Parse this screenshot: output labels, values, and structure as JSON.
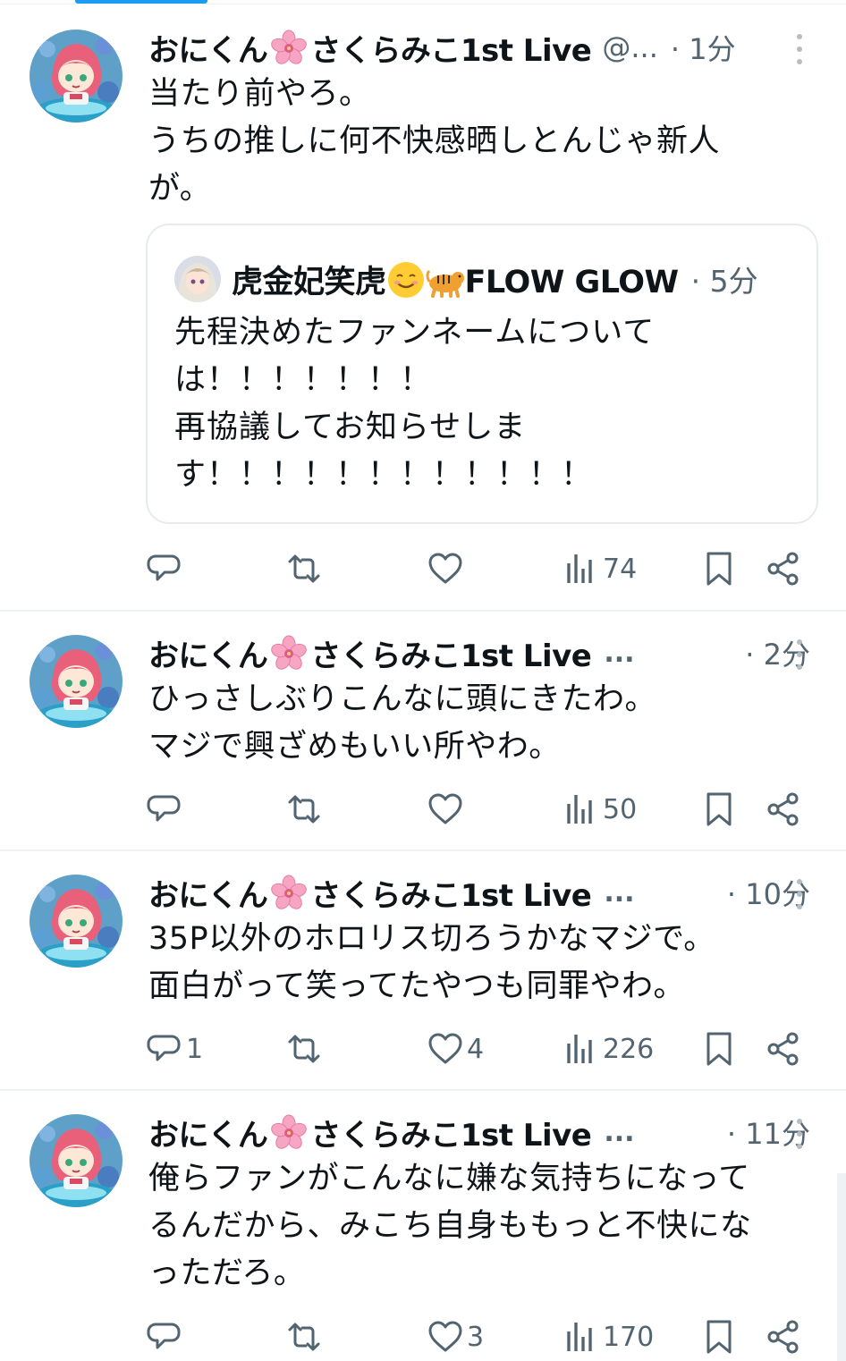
{
  "tweets": [
    {
      "name": "おにくん",
      "name2": "さくらみこ1st Live",
      "handle": "@...",
      "time": "· 1分",
      "lines": [
        "当たり前やろ。",
        "うちの推しに何不快感晒しとんじゃ新人",
        "が。"
      ],
      "quote": {
        "name": "虎金妃笑虎",
        "name2": "FLOW GLOW",
        "time": "· 5分",
        "lines": [
          "先程決めたファンネームについて",
          "は！！！！！！！",
          "再協議してお知らせしま",
          "す！！！！！！！！！！！！"
        ]
      },
      "reply_count": "",
      "retweet_count": "",
      "like_count": "",
      "views": "74"
    },
    {
      "name": "おにくん",
      "name2": "さくらみこ1st Live",
      "ellipsis": "...",
      "time": "· 2分",
      "lines": [
        "ひっさしぶりこんなに頭にきたわ。",
        "マジで興ざめもいい所やわ。"
      ],
      "reply_count": "",
      "retweet_count": "",
      "like_count": "",
      "views": "50"
    },
    {
      "name": "おにくん",
      "name2": "さくらみこ1st Live",
      "ellipsis": "...",
      "time": "· 10分",
      "lines": [
        "35P以外のホロリス切ろうかなマジで。",
        "面白がって笑ってたやつも同罪やわ。"
      ],
      "reply_count": "1",
      "retweet_count": "",
      "like_count": "4",
      "views": "226"
    },
    {
      "name": "おにくん",
      "name2": "さくらみこ1st Live",
      "ellipsis": "...",
      "time": "· 11分",
      "lines": [
        "俺らファンがこんなに嫌な気持ちになって",
        "るんだから、みこち自身ももっと不快にな",
        "っただろ。"
      ],
      "reply_count": "",
      "retweet_count": "",
      "like_count": "3",
      "views": "170"
    }
  ],
  "icons": {
    "reply": "reply-icon",
    "retweet": "retweet-icon",
    "like": "heart-icon",
    "views": "views-icon",
    "bookmark": "bookmark-icon",
    "share": "share-icon",
    "more": "more-icon"
  },
  "colors": {
    "text": "#0f1419",
    "secondary": "#536471",
    "accent": "#1d9bf0",
    "divider": "#eff3f4"
  }
}
